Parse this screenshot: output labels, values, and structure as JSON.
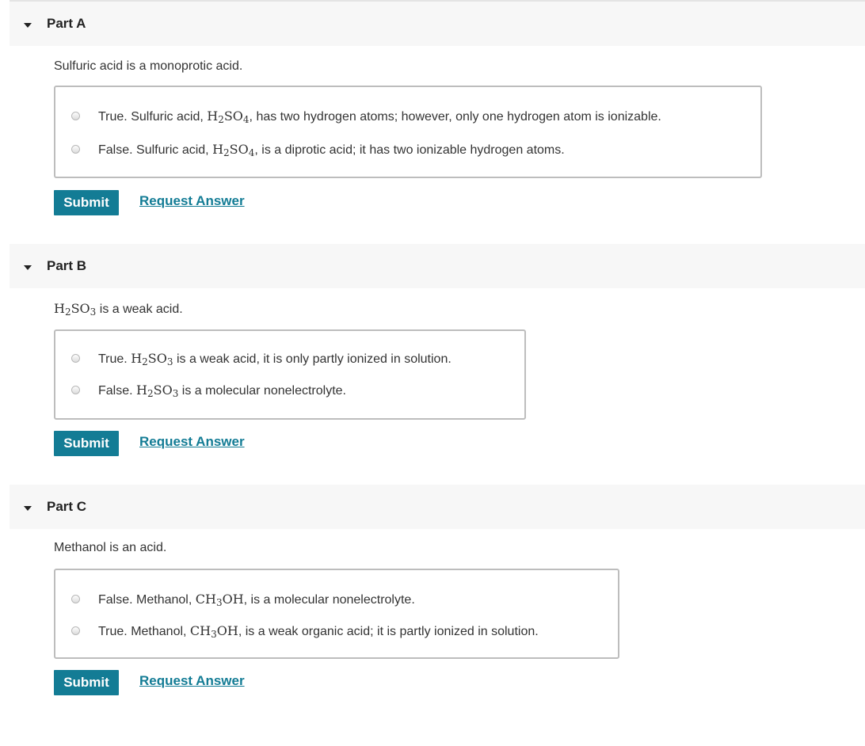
{
  "parts": [
    {
      "title": "Part A",
      "question": "Sulfuric acid is a monoprotic acid.",
      "options": [
        {
          "pre": "True. Sulfuric acid, ",
          "f1": "H",
          "n1": "2",
          "f2": "SO",
          "n2": "4",
          "post": ", has two hydrogen atoms; however, only one hydrogen atom is ionizable."
        },
        {
          "pre": "False. Sulfuric acid, ",
          "f1": "H",
          "n1": "2",
          "f2": "SO",
          "n2": "4",
          "post": ", is a diprotic acid; it has two ionizable hydrogen atoms."
        }
      ],
      "submit_label": "Submit",
      "request_label": "Request Answer"
    },
    {
      "title": "Part B",
      "question": {
        "f1": "H",
        "n1": "2",
        "f2": "SO",
        "n2": "3",
        "post": " is a weak acid."
      },
      "options": [
        {
          "pre": "True. ",
          "f1": "H",
          "n1": "2",
          "f2": "SO",
          "n2": "3",
          "post": " is a weak acid, it is only partly ionized in solution."
        },
        {
          "pre": "False. ",
          "f1": "H",
          "n1": "2",
          "f2": "SO",
          "n2": "3",
          "post": " is a molecular nonelectrolyte."
        }
      ],
      "submit_label": "Submit",
      "request_label": "Request Answer"
    },
    {
      "title": "Part C",
      "question": "Methanol is an acid.",
      "options": [
        {
          "pre": "False. Methanol, ",
          "f1": "CH",
          "n1": "3",
          "f2": "OH",
          "post": ", is a molecular nonelectrolyte."
        },
        {
          "pre": "True. Methanol, ",
          "f1": "CH",
          "n1": "3",
          "f2": "OH",
          "post": ", is a weak organic acid; it is partly ionized in solution."
        }
      ],
      "submit_label": "Submit",
      "request_label": "Request Answer"
    }
  ]
}
